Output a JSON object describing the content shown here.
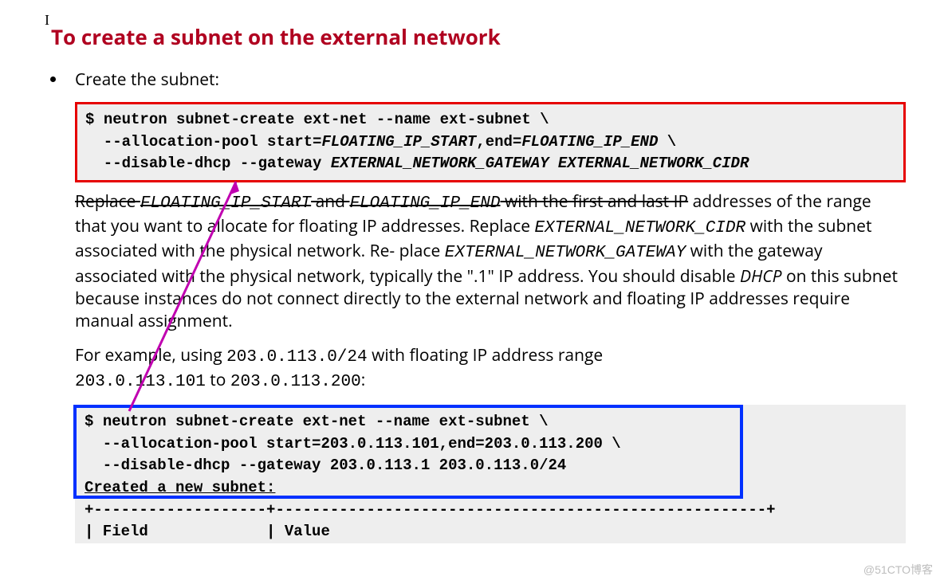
{
  "title": "To create a subnet on the external network",
  "step_label": "Create the subnet:",
  "code1": {
    "prompt": "$",
    "cmd": "neutron subnet-create ext-net --name ext-subnet \\",
    "line2a": "  --allocation-pool start=",
    "line2b": "FLOATING_IP_START",
    "line2c": ",end=",
    "line2d": "FLOATING_IP_END",
    "line2e": " \\",
    "line3a": "  --disable-dhcp --gateway ",
    "line3b": "EXTERNAL_NETWORK_GATEWAY EXTERNAL_NETWORK_CIDR"
  },
  "explain": {
    "t1": "Replace ",
    "v1": "FLOATING_IP_START",
    "t2": " and ",
    "v2": "FLOATING_IP_END",
    "t3": " with the first and last IP",
    "t4": "addresses of the range that you want to allocate for floating IP addresses. Replace ",
    "v3": "EXTERNAL_NETWORK_CIDR",
    "t5": " with the subnet associated with the physical network. Re-",
    "t6": "place ",
    "v4": "EXTERNAL_NETWORK_GATEWAY",
    "t7": " with the gateway associated with the physical network, typically the \".1\" IP address. You should disable ",
    "dhcp": "DHCP",
    "t8": " on this subnet because instances do not connect directly to the external network and floating IP addresses require manual assignment."
  },
  "example": {
    "t1": "For example, using ",
    "cidr": "203.0.113.0/24",
    "t2": " with floating IP address range ",
    "r1": "203.0.113.101",
    "t3": " to ",
    "r2": "203.0.113.200",
    "t4": ":"
  },
  "code2": {
    "prompt": "$",
    "cmd": "neutron subnet-create ext-net --name ext-subnet \\",
    "line2": "  --allocation-pool start=203.0.113.101,end=203.0.113.200 \\",
    "line3": "  --disable-dhcp --gateway 203.0.113.1 203.0.113.0/24"
  },
  "output": {
    "created": "Created a new subnet:",
    "sep1": "+-------------------+------------------------------------------------------+",
    "hdr": "| Field             | Value"
  },
  "watermark": "@51CTO博客"
}
